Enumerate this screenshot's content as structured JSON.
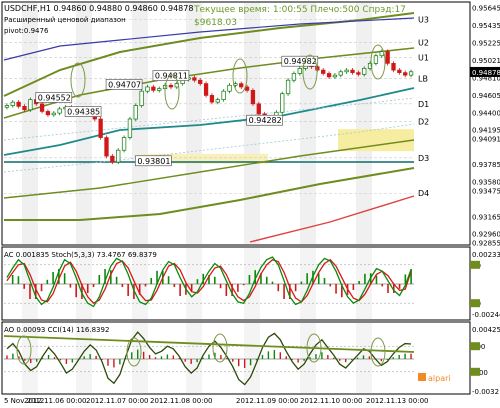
{
  "header": {
    "symbol_line": "USDCHF,H1  0.94860 0.94880 0.94860 0.94878",
    "indicator_caption": "Расширенный ценовой диапазон",
    "pivot_caption": "pivot:0.9476",
    "time_info": "Текущее время: 1:00:55 Плечо:500  Спрэд:17",
    "balance": "$9618.03"
  },
  "chart_data": [
    {
      "type": "line",
      "title": "USDCHF,H1",
      "price_axis": [
        "0.95645",
        "0.95435",
        "0.95225",
        "0.95021",
        "0.94810",
        "0.94605",
        "0.94400",
        "0.94195",
        "0.94091",
        "0.93785",
        "0.93580",
        "0.93475",
        "0.93165",
        "0.92960",
        "0.92855"
      ],
      "ylim": [
        0.9285,
        0.9566
      ],
      "last_price": "0.94878",
      "levels": [
        {
          "name": "U3",
          "value": 0.955
        },
        {
          "name": "U2",
          "value": 0.9523
        },
        {
          "name": "U1",
          "value": 0.9505
        },
        {
          "name": "LB",
          "value": 0.948
        },
        {
          "name": "D1",
          "value": 0.945
        },
        {
          "name": "D2",
          "value": 0.9429
        },
        {
          "name": "D3",
          "value": 0.9386
        },
        {
          "name": "D4",
          "value": 0.9344
        }
      ],
      "price_labels": [
        {
          "text": "0.94552",
          "value": 0.94552
        },
        {
          "text": "0.94385",
          "value": 0.94385
        },
        {
          "text": "0.94707",
          "value": 0.94707
        },
        {
          "text": "0.94811",
          "value": 0.94811
        },
        {
          "text": "0.94982",
          "value": 0.94982
        },
        {
          "text": "0.94282",
          "value": 0.94282
        },
        {
          "text": "0.93801",
          "value": 0.93801
        }
      ],
      "close_series": [
        0.9448,
        0.9452,
        0.9447,
        0.9443,
        0.9455,
        0.945,
        0.9441,
        0.9437,
        0.9439,
        0.9444,
        0.9446,
        0.9441,
        0.9439,
        0.944,
        0.9438,
        0.9432,
        0.941,
        0.9388,
        0.9381,
        0.9395,
        0.941,
        0.9432,
        0.9448,
        0.9465,
        0.947,
        0.9466,
        0.9468,
        0.9472,
        0.947,
        0.9474,
        0.9479,
        0.9481,
        0.9478,
        0.9474,
        0.946,
        0.9452,
        0.9455,
        0.9465,
        0.9472,
        0.9474,
        0.947,
        0.9466,
        0.945,
        0.9438,
        0.9431,
        0.9428,
        0.944,
        0.9462,
        0.9478,
        0.9486,
        0.9492,
        0.9497,
        0.9494,
        0.949,
        0.9486,
        0.9482,
        0.9484,
        0.9488,
        0.949,
        0.9487,
        0.9485,
        0.9492,
        0.9498,
        0.9507,
        0.9512,
        0.9498,
        0.949,
        0.9487,
        0.9484,
        0.9488
      ]
    },
    {
      "type": "line",
      "title": "AC 0.001835  Stoch(5,3,3) 73.4767 69.8379",
      "value_axis": [
        "0.002339",
        "80",
        "20",
        "-0.002441"
      ],
      "ylim": [
        0,
        100
      ],
      "stoch_main": [
        60,
        75,
        88,
        80,
        55,
        30,
        18,
        25,
        45,
        70,
        88,
        82,
        60,
        35,
        20,
        15,
        30,
        55,
        78,
        90,
        85,
        65,
        40,
        22,
        18,
        28,
        50,
        72,
        85,
        80,
        60,
        42,
        30,
        38,
        55,
        70,
        82,
        75,
        55,
        35,
        22,
        20,
        35,
        58,
        76,
        88,
        92,
        80,
        55,
        30,
        18,
        22,
        40,
        62,
        80,
        90,
        86,
        70,
        48,
        30,
        20,
        25,
        42,
        60,
        74,
        70,
        55,
        40,
        32,
        48,
        73
      ],
      "stoch_signal": [
        55,
        68,
        80,
        82,
        65,
        42,
        25,
        22,
        35,
        58,
        78,
        84,
        70,
        48,
        30,
        20,
        25,
        42,
        65,
        82,
        86,
        75,
        55,
        35,
        24,
        25,
        40,
        60,
        78,
        82,
        72,
        52,
        38,
        36,
        46,
        62,
        75,
        78,
        65,
        45,
        30,
        24,
        30,
        46,
        66,
        80,
        88,
        85,
        68,
        45,
        28,
        22,
        32,
        50,
        68,
        82,
        88,
        78,
        60,
        42,
        28,
        24,
        34,
        50,
        65,
        70,
        63,
        50,
        40,
        42,
        70
      ]
    },
    {
      "type": "line",
      "title": "AO 0.00093  CCI(14) 116.8392",
      "value_axis": [
        "0.004257",
        "100",
        "-100",
        "-0.0032"
      ],
      "ylim": [
        -250,
        250
      ],
      "cci": [
        80,
        120,
        60,
        -40,
        -90,
        -60,
        20,
        90,
        40,
        -30,
        -110,
        -80,
        -10,
        60,
        110,
        70,
        -20,
        -150,
        -190,
        -120,
        20,
        150,
        210,
        160,
        90,
        40,
        60,
        100,
        80,
        20,
        -60,
        -110,
        -70,
        30,
        100,
        140,
        90,
        20,
        -60,
        -160,
        -200,
        -140,
        -30,
        90,
        170,
        200,
        150,
        60,
        -20,
        -80,
        -40,
        40,
        110,
        150,
        90,
        30,
        -40,
        -70,
        -20,
        30,
        80,
        60,
        0,
        -50,
        -20,
        40,
        90,
        120,
        117
      ]
    },
    {
      "type": "table",
      "title": "time axis",
      "time_labels": [
        "5 Nov 2012",
        "2012.11.06 00:00",
        "2012.11.07 00:00",
        "2012.11.08 00:00",
        "2012.11.09 00:00",
        "2012.11.10 00:00",
        "2012.11.13 00:00"
      ]
    }
  ],
  "watermark": "alpari"
}
